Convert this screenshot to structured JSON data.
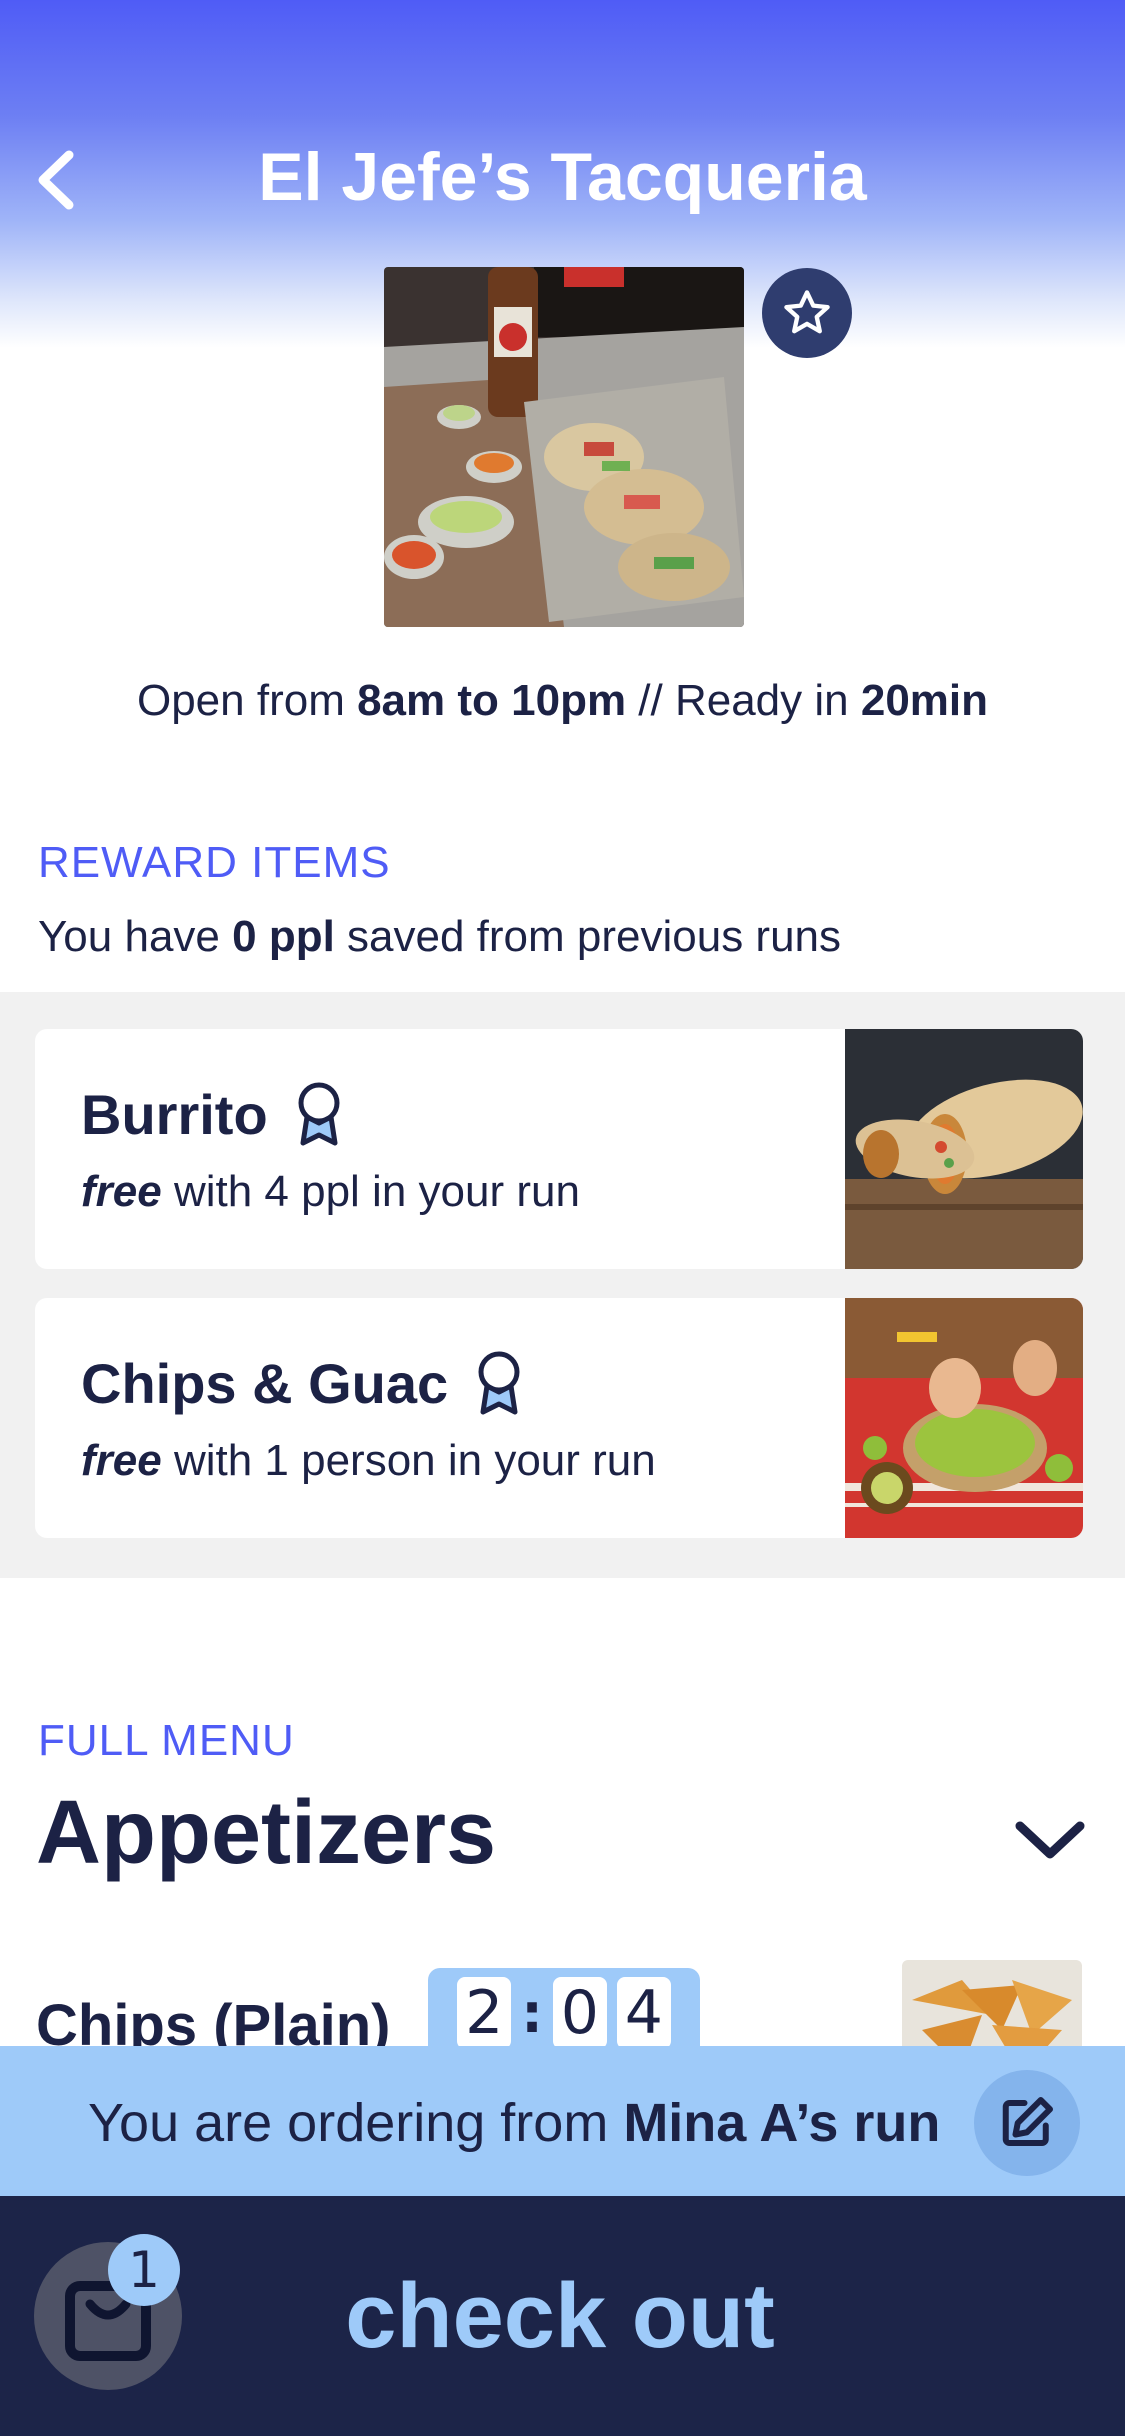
{
  "header": {
    "title": "El Jefe’s Tacqueria",
    "back_icon": "chevron-left-icon",
    "favorite_icon": "star-icon"
  },
  "hours": {
    "prefix": "Open from ",
    "hours": "8am to 10pm",
    "separator": " // Ready in ",
    "ready_time": "20min"
  },
  "rewards": {
    "section_label": "REWARD ITEMS",
    "saved_prefix": "You have ",
    "saved_count": "0 ppl",
    "saved_suffix": " saved from previous runs",
    "items": [
      {
        "name": "Burrito",
        "free_word": "free",
        "condition": " with 4 ppl in your run",
        "badge_icon": "award-ribbon-icon"
      },
      {
        "name": "Chips & Guac",
        "free_word": "free",
        "condition": " with 1 person in your run",
        "badge_icon": "award-ribbon-icon"
      }
    ]
  },
  "menu": {
    "section_label": "FULL MENU",
    "category": "Appetizers",
    "toggle_icon": "chevron-down-icon",
    "items": [
      {
        "name": "Chips (Plain)"
      }
    ]
  },
  "timer": {
    "minutes": "2",
    "seconds_tens": "0",
    "seconds_ones": "4",
    "colon": ":"
  },
  "order_bar": {
    "prefix": "You are ordering from ",
    "run_owner": "Mina A’s run",
    "edit_icon": "edit-pencil-icon"
  },
  "checkout": {
    "label": "check out",
    "cart_count": "1",
    "cart_icon": "shopping-bag-icon"
  },
  "colors": {
    "accent": "#4f5cf6",
    "navy": "#1c2448",
    "light_blue": "#9ecaf9",
    "panel_gray": "#f1f1f1"
  }
}
